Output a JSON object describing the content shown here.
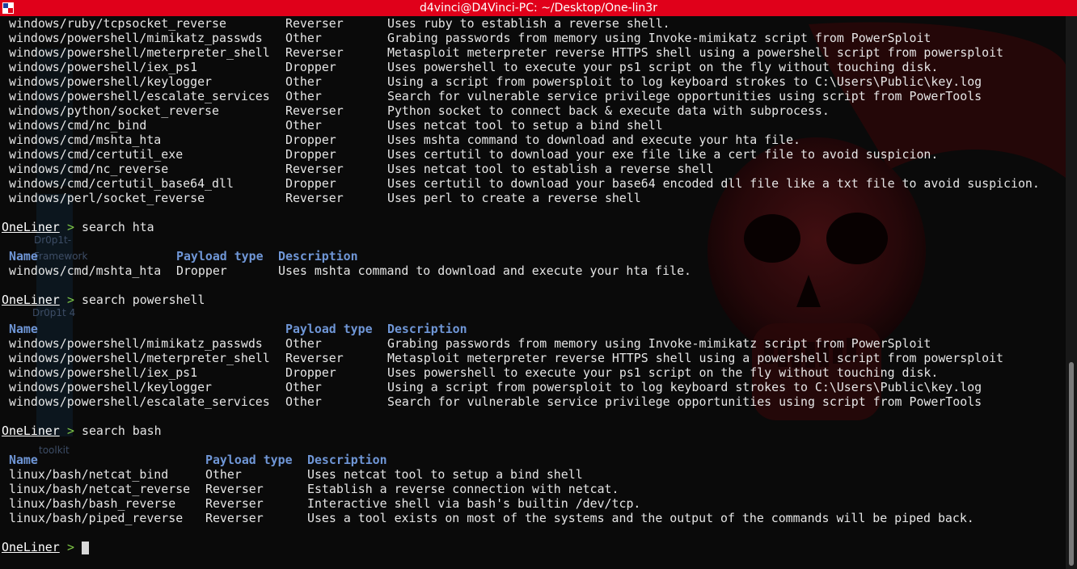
{
  "window": {
    "title": "d4vinci@D4Vinci-PC: ~/Desktop/One-lin3r"
  },
  "prompt": {
    "name": "OneLiner",
    "arrow": ">"
  },
  "desktop_shortcuts": [
    "Dr0p1t-",
    "Framework",
    "Dr0p1t 4",
    "toolkit"
  ],
  "colors": {
    "titlebar": "#e0001a",
    "header": "#6f96d6",
    "prompt_arrow": "#7fc846",
    "background": "#0a0a0a"
  },
  "headers": {
    "name": "Name",
    "type": "Payload type",
    "desc": "Description"
  },
  "top_listing": [
    {
      "name": "windows/ruby/tcpsocket_reverse",
      "type": "Reverser",
      "desc": "Uses ruby to establish a reverse shell."
    },
    {
      "name": "windows/powershell/mimikatz_passwds",
      "type": "Other",
      "desc": "Grabing passwords from memory using Invoke-mimikatz script from PowerSploit"
    },
    {
      "name": "windows/powershell/meterpreter_shell",
      "type": "Reverser",
      "desc": "Metasploit meterpreter reverse HTTPS shell using a powershell script from powersploit"
    },
    {
      "name": "windows/powershell/iex_ps1",
      "type": "Dropper",
      "desc": "Uses powershell to execute your ps1 script on the fly without touching disk."
    },
    {
      "name": "windows/powershell/keylogger",
      "type": "Other",
      "desc": "Using a script from powersploit to log keyboard strokes to C:\\Users\\Public\\key.log"
    },
    {
      "name": "windows/powershell/escalate_services",
      "type": "Other",
      "desc": "Search for vulnerable service privilege opportunities using script from PowerTools"
    },
    {
      "name": "windows/python/socket_reverse",
      "type": "Reverser",
      "desc": "Python socket to connect back & execute data with subprocess."
    },
    {
      "name": "windows/cmd/nc_bind",
      "type": "Other",
      "desc": "Uses netcat tool to setup a bind shell"
    },
    {
      "name": "windows/cmd/mshta_hta",
      "type": "Dropper",
      "desc": "Uses mshta command to download and execute your hta file."
    },
    {
      "name": "windows/cmd/certutil_exe",
      "type": "Dropper",
      "desc": "Uses certutil to download your exe file like a cert file to avoid suspicion."
    },
    {
      "name": "windows/cmd/nc_reverse",
      "type": "Reverser",
      "desc": "Uses netcat tool to establish a reverse shell"
    },
    {
      "name": "windows/cmd/certutil_base64_dll",
      "type": "Dropper",
      "desc": "Uses certutil to download your base64 encoded dll file like a txt file to avoid suspicion."
    },
    {
      "name": "windows/perl/socket_reverse",
      "type": "Reverser",
      "desc": "Uses perl to create a reverse shell"
    }
  ],
  "searches": [
    {
      "command": "search hta",
      "rows": [
        {
          "name": "windows/cmd/mshta_hta",
          "type": "Dropper",
          "desc": "Uses mshta command to download and execute your hta file."
        }
      ]
    },
    {
      "command": "search powershell",
      "rows": [
        {
          "name": "windows/powershell/mimikatz_passwds",
          "type": "Other",
          "desc": "Grabing passwords from memory using Invoke-mimikatz script from PowerSploit"
        },
        {
          "name": "windows/powershell/meterpreter_shell",
          "type": "Reverser",
          "desc": "Metasploit meterpreter reverse HTTPS shell using a powershell script from powersploit"
        },
        {
          "name": "windows/powershell/iex_ps1",
          "type": "Dropper",
          "desc": "Uses powershell to execute your ps1 script on the fly without touching disk."
        },
        {
          "name": "windows/powershell/keylogger",
          "type": "Other",
          "desc": "Using a script from powersploit to log keyboard strokes to C:\\Users\\Public\\key.log"
        },
        {
          "name": "windows/powershell/escalate_services",
          "type": "Other",
          "desc": "Search for vulnerable service privilege opportunities using script from PowerTools"
        }
      ]
    },
    {
      "command": "search bash",
      "rows": [
        {
          "name": "linux/bash/netcat_bind",
          "type": "Other",
          "desc": "Uses netcat tool to setup a bind shell"
        },
        {
          "name": "linux/bash/netcat_reverse",
          "type": "Reverser",
          "desc": "Establish a reverse connection with netcat."
        },
        {
          "name": "linux/bash/bash_reverse",
          "type": "Reverser",
          "desc": "Interactive shell via bash's builtin /dev/tcp."
        },
        {
          "name": "linux/bash/piped_reverse",
          "type": "Reverser",
          "desc": "Uses a tool exists on most of the systems and the output of the commands will be piped back."
        }
      ]
    }
  ]
}
